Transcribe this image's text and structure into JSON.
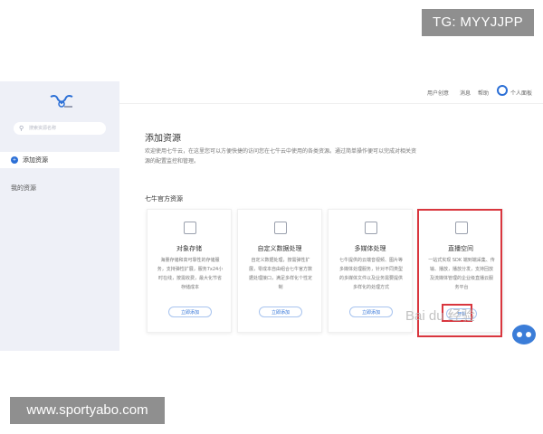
{
  "overlays": {
    "top_right_text": "TG: MYYJJPP",
    "bottom_left_text": "www.sportyabo.com"
  },
  "sidebar": {
    "search_placeholder": "搜索资源名称",
    "active_item": "添加资源",
    "mine_item": "我的资源"
  },
  "topbar": {
    "items": [
      "用户创意",
      "消息",
      "帮助"
    ],
    "user_label": "个人面板"
  },
  "main": {
    "title": "添加资源",
    "description": "欢迎使用七牛云，在这里您可以方便快捷的访问您在七牛云中使用的各类资源。通过简单操作便可以完成对相关资源的配置监控和管理。",
    "section_title": "七牛官方资源",
    "cards": [
      {
        "title": "对象存储",
        "desc": "海量存储和高可靠性的存储服务，支持弹性扩展，服务7x24小时在线，按需收费，最大化节省存储成本",
        "button": "立即添加",
        "icon": "storage-icon"
      },
      {
        "title": "自定义数据处理",
        "desc": "自定义数据处理，按需弹性扩展，零成本自由组合七牛官方数据处理接口，满足多样化个性定制",
        "button": "立即添加",
        "icon": "processing-icon"
      },
      {
        "title": "多媒体处理",
        "desc": "七牛提供的云端音视频、图片等多媒体处理服务，针对不同类型的多媒体文件以及业务需要提供多样化的处理方式",
        "button": "立即添加",
        "icon": "media-icon"
      },
      {
        "title": "直播空间",
        "desc": "一站式实现 SDK 端到端采集、传输、播放，播放分发，支持回放及流媒体管理的企业级直播云服务平台",
        "button": "开始",
        "icon": "live-icon"
      }
    ]
  },
  "watermark": "Bai du 经验",
  "colors": {
    "accent": "#2b6fd6",
    "highlight": "#d9363e",
    "sidebar_bg": "#eef0f7"
  }
}
